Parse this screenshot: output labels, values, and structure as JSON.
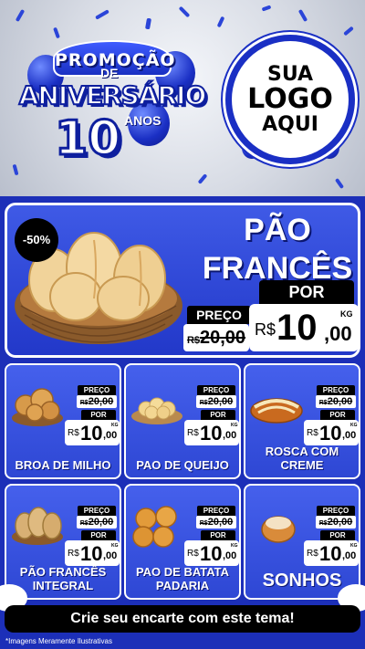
{
  "header": {
    "promo_title": "PROMOÇÃO",
    "promo_de": "DE",
    "promo_anniversary": "ANIVERSÁRIO",
    "promo_number": "10",
    "promo_anos": "ANOS",
    "logo_line1": "SUA",
    "logo_line2": "LOGO",
    "logo_line3": "AQUI"
  },
  "featured": {
    "discount": "-50%",
    "name_line1": "PÃO",
    "name_line2": "FRANCÊS",
    "preco_label": "PREÇO",
    "old_currency": "R$",
    "old_price": "20,00",
    "por_label": "POR",
    "currency": "R$",
    "price_int": "10",
    "price_dec": ",00",
    "unit": "KG"
  },
  "products": [
    {
      "name": "BROA DE MILHO",
      "preco_label": "PREÇO",
      "old_currency": "R$",
      "old_price": "20,00",
      "por_label": "POR",
      "currency": "R$",
      "price_int": "10",
      "price_dec": ",00",
      "unit": "KG"
    },
    {
      "name": "PAO DE QUEIJO",
      "preco_label": "PREÇO",
      "old_currency": "R$",
      "old_price": "20,00",
      "por_label": "POR",
      "currency": "R$",
      "price_int": "10",
      "price_dec": ",00",
      "unit": "KG"
    },
    {
      "name": "ROSCA COM CREME",
      "preco_label": "PREÇO",
      "old_currency": "R$",
      "old_price": "20,00",
      "por_label": "POR",
      "currency": "R$",
      "price_int": "10",
      "price_dec": ",00",
      "unit": "KG"
    },
    {
      "name": "PÃO FRANCÊS INTEGRAL",
      "preco_label": "PREÇO",
      "old_currency": "R$",
      "old_price": "20,00",
      "por_label": "POR",
      "currency": "R$",
      "price_int": "10",
      "price_dec": ",00",
      "unit": "KG"
    },
    {
      "name": "PAO DE BATATA PADARIA",
      "preco_label": "PREÇO",
      "old_currency": "R$",
      "old_price": "20,00",
      "por_label": "POR",
      "currency": "R$",
      "price_int": "10",
      "price_dec": ",00",
      "unit": "KG"
    },
    {
      "name": "SONHOS",
      "preco_label": "PREÇO",
      "old_currency": "R$",
      "old_price": "20,00",
      "por_label": "POR",
      "currency": "R$",
      "price_int": "10",
      "price_dec": ",00",
      "unit": "KG"
    }
  ],
  "cta": "Crie seu encarte com este tema!",
  "footnote": "*Imagens Meramente Ilustrativas",
  "colors": {
    "primary": "#1c2fb8",
    "card": "#3f5ae6",
    "label_bg": "#000000",
    "text": "#ffffff"
  }
}
